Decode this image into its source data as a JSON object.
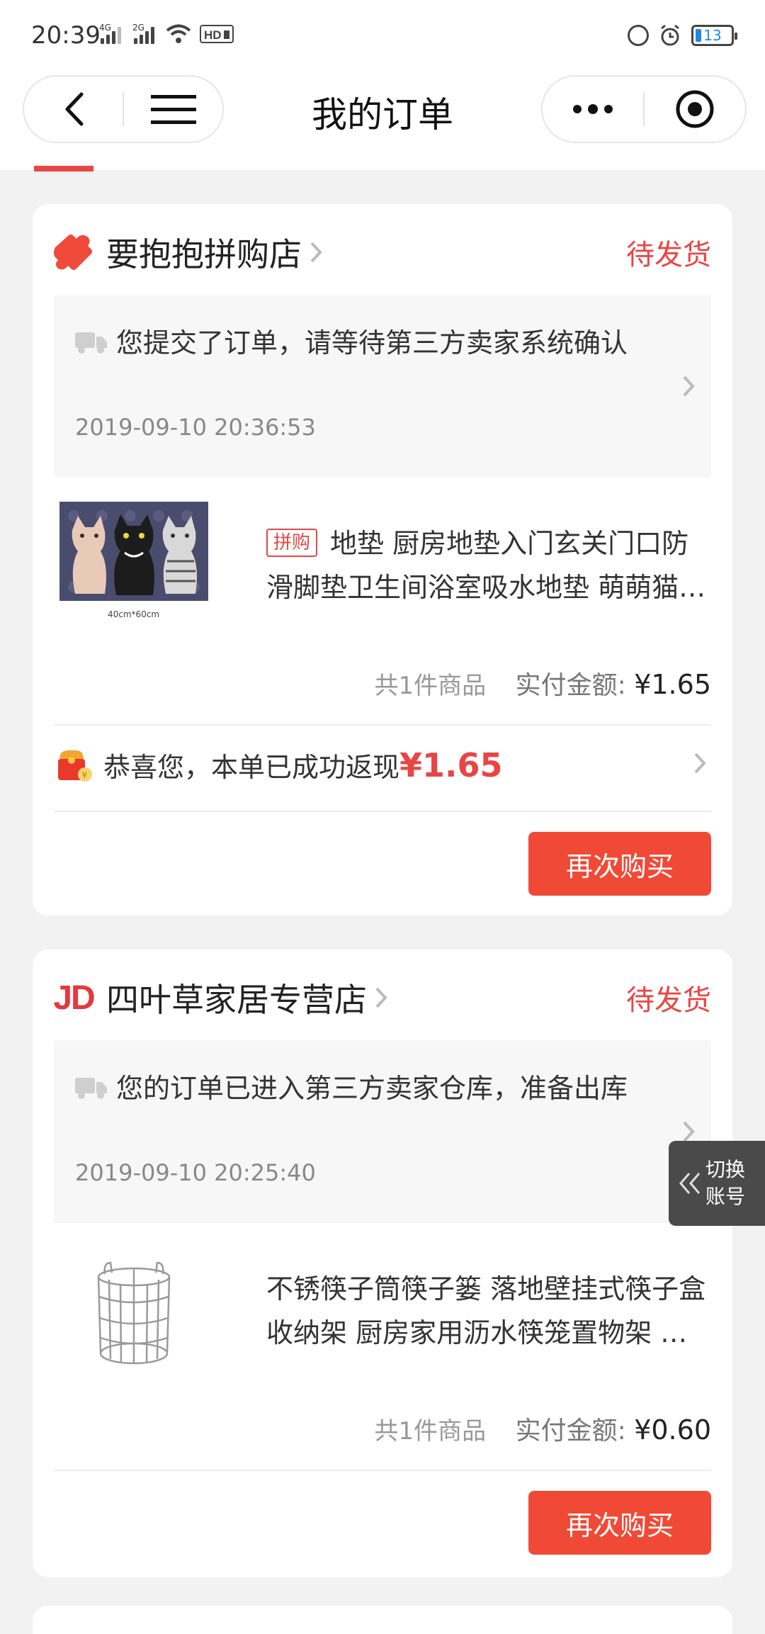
{
  "status_bar": {
    "time": "20:39",
    "network_1": "4G",
    "network_2": "2G",
    "battery": "13"
  },
  "nav": {
    "title": "我的订单"
  },
  "orders": [
    {
      "store_name": "要抱抱拼购店",
      "status": "待发货",
      "logistics_text": "您提交了订单，请等待第三方卖家系统确认",
      "logistics_time": "2019-09-10 20:36:53",
      "badge": "拼购",
      "product_title": "地垫 厨房地垫入门玄关门口防滑脚垫卫生间浴室吸水地垫 萌萌猫…",
      "thumb_caption": "40cm*60cm",
      "item_count": "共1件商品",
      "paid_label": "实付金额:",
      "paid_amount": "¥1.65",
      "cashback_text": "恭喜您，本单已成功返现",
      "cashback_amount": "¥1.65",
      "buy_again": "再次购买"
    },
    {
      "store_logo": "JD",
      "store_name": "四叶草家居专营店",
      "status": "待发货",
      "logistics_text": "您的订单已进入第三方卖家仓库，准备出库",
      "logistics_time": "2019-09-10 20:25:40",
      "product_title": "不锈筷子筒筷子篓 落地壁挂式筷子盒收纳架 厨房家用沥水筷笼置物架 …",
      "item_count": "共1件商品",
      "paid_label": "实付金额:",
      "paid_amount": "¥0.60",
      "buy_again": "再次购买"
    }
  ],
  "switch_account": {
    "line1": "切换",
    "line2": "账号"
  },
  "colors": {
    "accent": "#e94545",
    "button": "#f04a37"
  }
}
